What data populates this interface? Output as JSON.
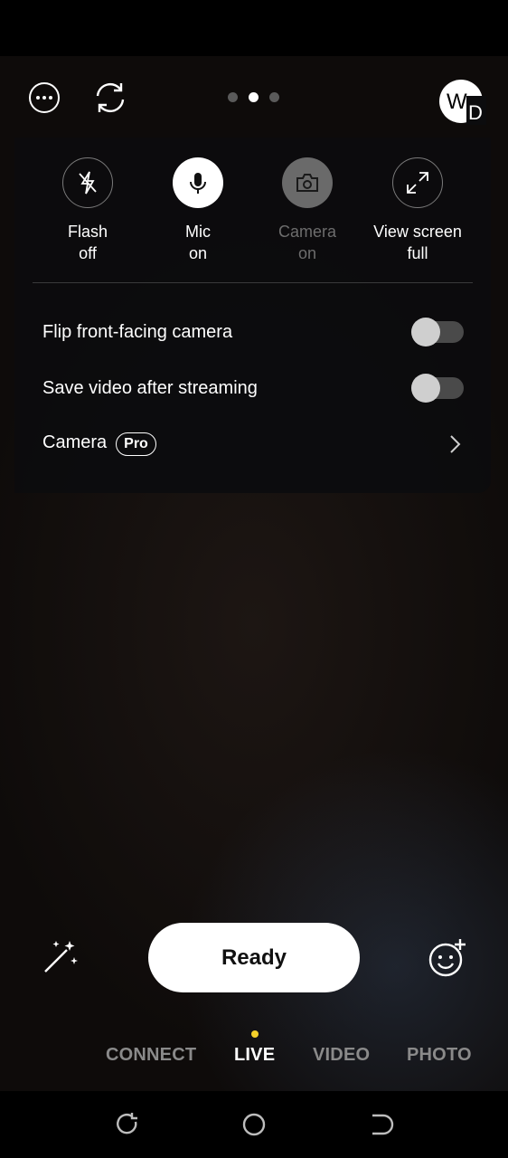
{
  "top_bar": {
    "icons": [
      "more-options-icon",
      "switch-camera-icon",
      "wd-logo"
    ],
    "page_indicator": {
      "count": 3,
      "active": 1
    },
    "logo_letters": [
      "W",
      "D"
    ]
  },
  "quick_settings": [
    {
      "line1": "Flash",
      "line2": "off",
      "icon": "flash-off-icon",
      "state": "outline"
    },
    {
      "line1": "Mic",
      "line2": "on",
      "icon": "mic-icon",
      "state": "filled"
    },
    {
      "line1": "Camera",
      "line2": "on",
      "icon": "camera-icon",
      "state": "disabled"
    },
    {
      "line1": "View screen",
      "line2": "full",
      "icon": "fullscreen-icon",
      "state": "outline"
    }
  ],
  "settings": {
    "flip_camera": {
      "label": "Flip front-facing camera",
      "on": false
    },
    "save_video": {
      "label": "Save video after streaming",
      "on": false
    },
    "camera": {
      "label": "Camera",
      "badge": "Pro"
    }
  },
  "ready_button": "Ready",
  "modes": [
    "CONNECT",
    "LIVE",
    "VIDEO",
    "PHOTO"
  ],
  "active_mode": "LIVE",
  "colors": {
    "accent_dot": "#f4d02a",
    "panel": "#0c0c0e"
  }
}
